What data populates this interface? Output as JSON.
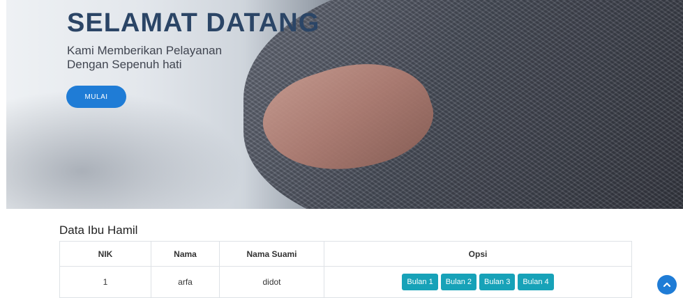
{
  "hero": {
    "title": "SELAMAT DATANG",
    "subtitle_line1": "Kami Memberikan Pelayanan",
    "subtitle_line2": "Dengan Sepenuh hati",
    "button_label": "MULAI"
  },
  "section": {
    "title": "Data Ibu Hamil"
  },
  "table": {
    "headers": [
      "NIK",
      "Nama",
      "Nama Suami",
      "Opsi"
    ],
    "rows": [
      {
        "nik": "1",
        "nama": "arfa",
        "nama_suami": "didot",
        "options": [
          "Bulan 1",
          "Bulan 2",
          "Bulan 3",
          "Bulan 4"
        ]
      }
    ]
  },
  "back_to_top_icon": "chevron-up-icon",
  "colors": {
    "primary": "#1f7cd6",
    "info": "#17a2b8",
    "title": "#2b4566"
  }
}
